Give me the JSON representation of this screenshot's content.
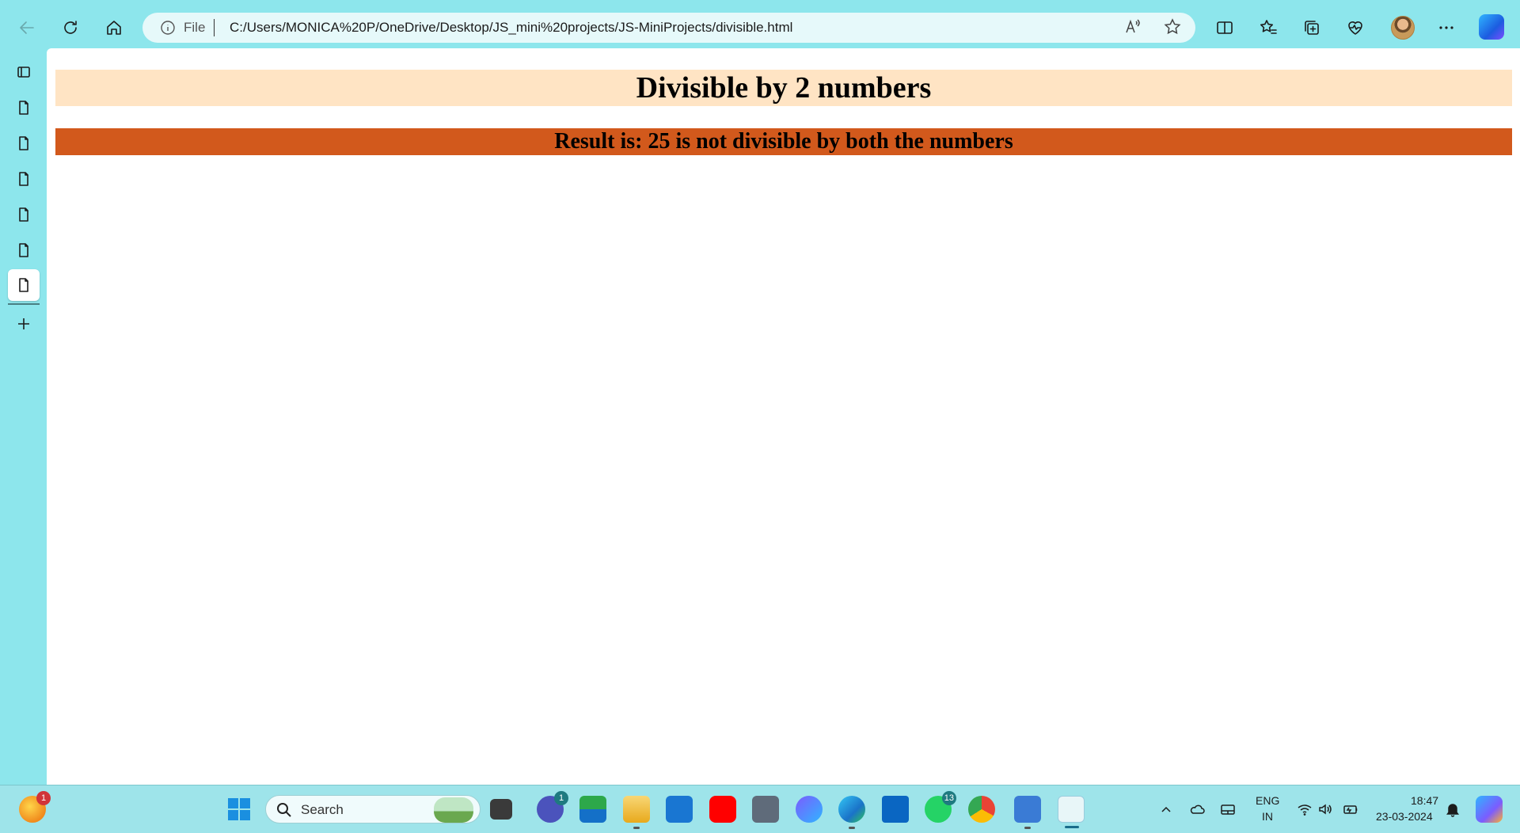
{
  "browser": {
    "address": {
      "scheme_label": "File",
      "url": "C:/Users/MONICA%20P/OneDrive/Desktop/JS_mini%20projects/JS-MiniProjects/divisible.html"
    }
  },
  "page": {
    "heading": "Divisible by 2 numbers",
    "result": "Result is: 25 is not divisible by both the numbers",
    "heading_bg": "#ffe4c4",
    "result_bg": "#d2591c"
  },
  "taskbar": {
    "search_label": "Search",
    "badges": {
      "weather": "1",
      "teams": "1",
      "whatsapp": "13"
    },
    "language": {
      "line1": "ENG",
      "line2": "IN"
    },
    "clock": {
      "time": "18:47",
      "date": "23-03-2024"
    }
  },
  "theme": {
    "chrome_color": "#8de6ec",
    "taskbar_color": "#9ee4ea"
  }
}
